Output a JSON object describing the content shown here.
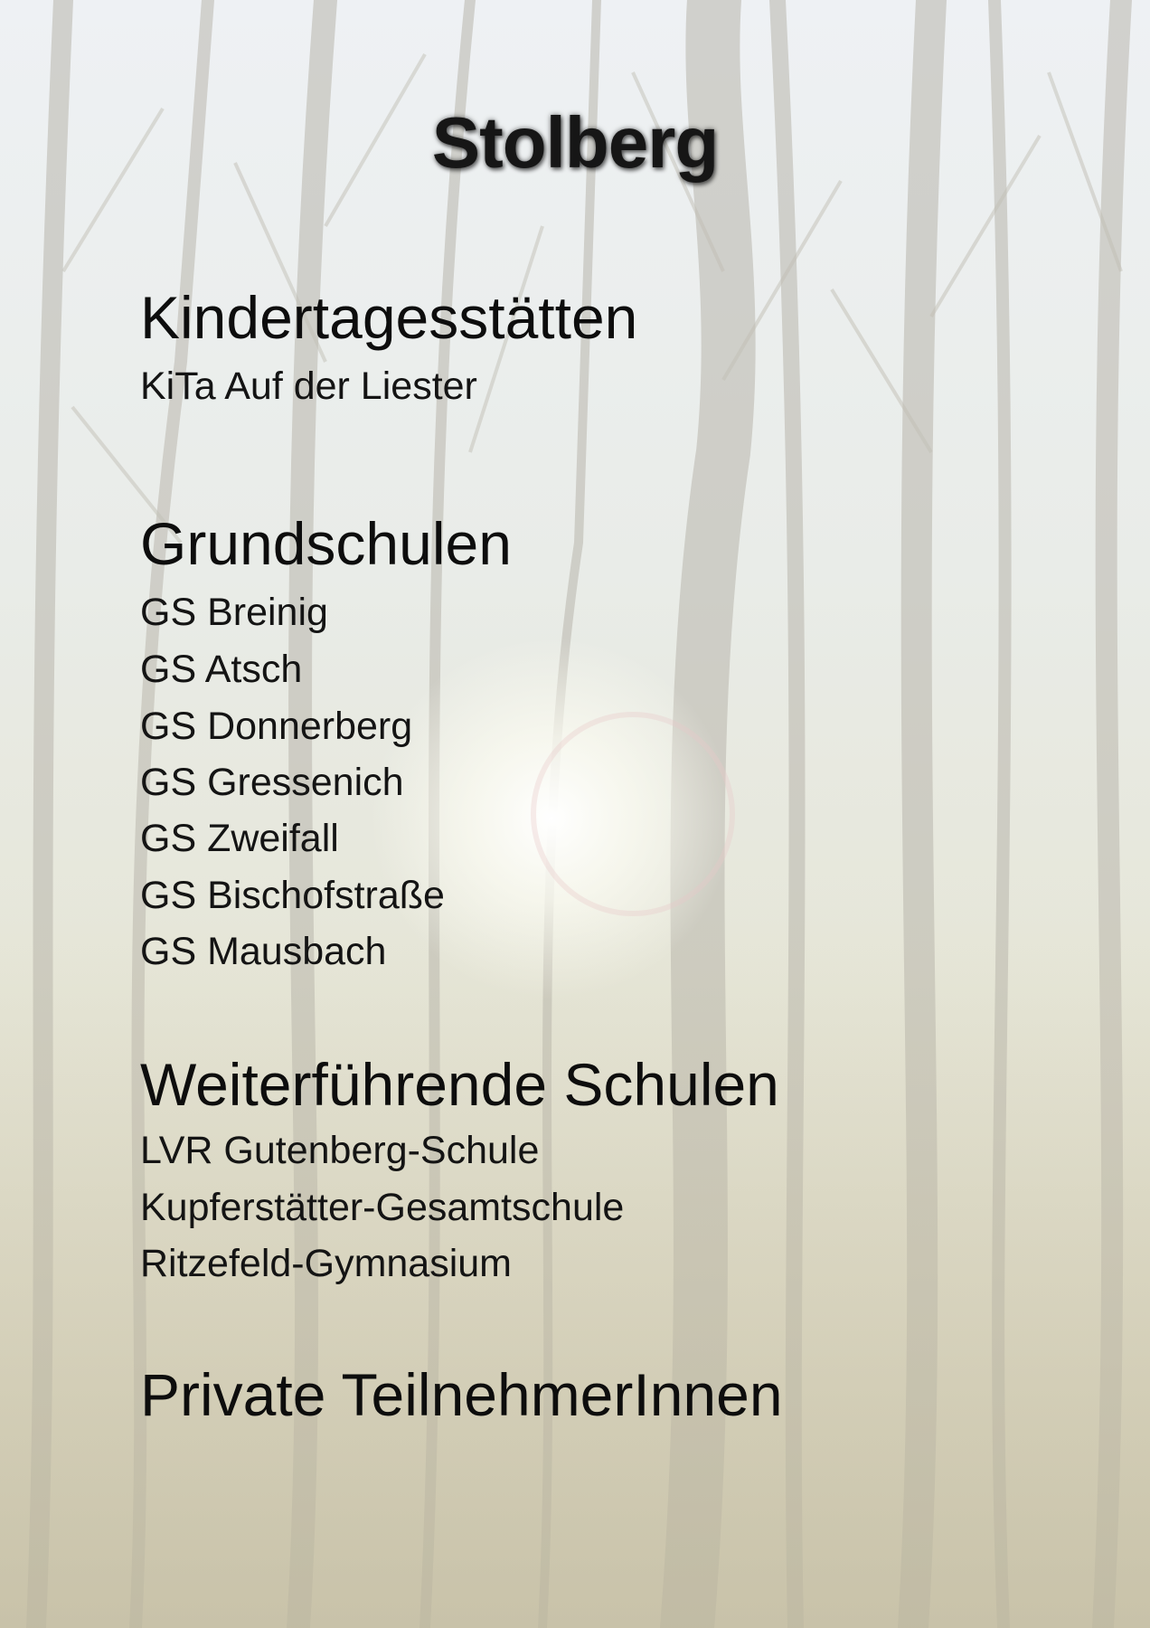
{
  "title": "Stolberg",
  "sections": [
    {
      "heading": "Kindertagesstätten",
      "items": [
        "KiTa Auf der Liester"
      ]
    },
    {
      "heading": "Grundschulen",
      "items": [
        "GS Breinig",
        "GS Atsch",
        "GS Donnerberg",
        "GS Gressenich",
        "GS Zweifall",
        "GS Bischofstraße",
        "GS Mausbach"
      ]
    },
    {
      "heading": "Weiterführende Schulen",
      "items": [
        "LVR Gutenberg-Schule",
        "Kupferstätter-Gesamtschule",
        "Ritzefeld-Gymnasium"
      ]
    },
    {
      "heading": "Private TeilnehmerInnen",
      "items": []
    }
  ]
}
